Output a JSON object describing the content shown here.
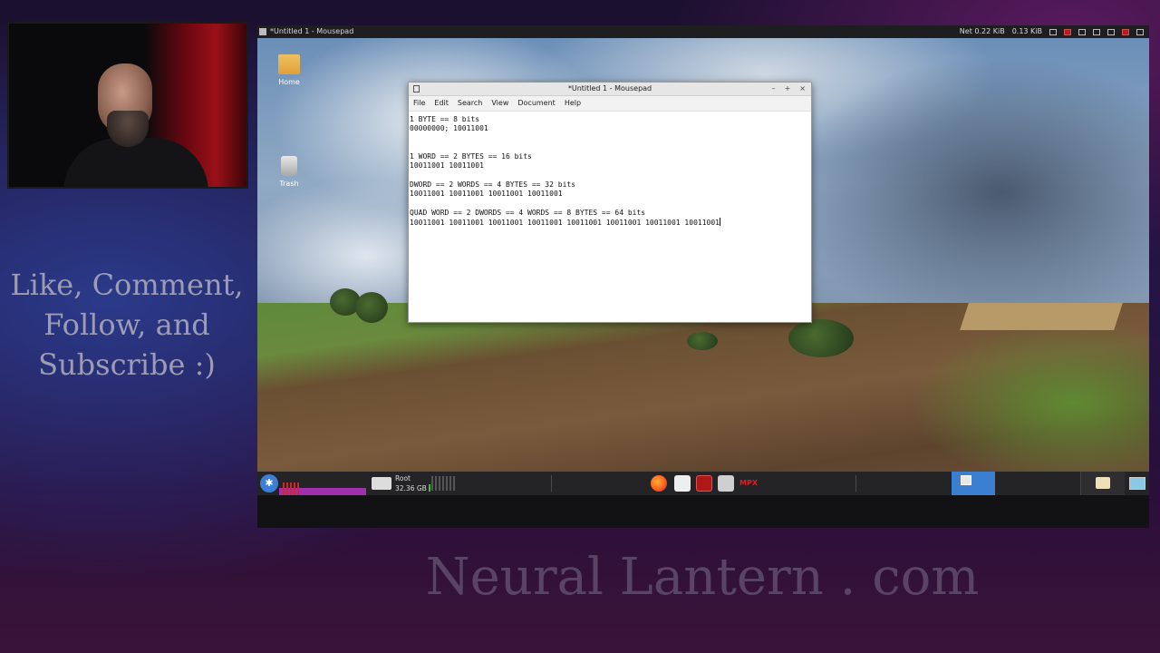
{
  "overlay": {
    "cta_lines": [
      "Like, Comment,",
      "Follow, and",
      "Subscribe :)"
    ],
    "brand": "Neural Lantern . com"
  },
  "top_panel": {
    "active_window": "*Untitled 1 - Mousepad",
    "net_label": "Net 0.22 KiB",
    "net_rate": "0.13 KiB"
  },
  "desktop_icons": [
    {
      "label": "Home",
      "icon": "folder-icon"
    },
    {
      "label": "Trash",
      "icon": "trash-icon"
    }
  ],
  "window": {
    "title": "*Untitled 1 - Mousepad",
    "controls": [
      "–",
      "+",
      "×"
    ],
    "menu": [
      "File",
      "Edit",
      "Search",
      "View",
      "Document",
      "Help"
    ],
    "lines": [
      "1 BYTE == 8 bits",
      "00000000; 10011001",
      "",
      "",
      "1 WORD == 2 BYTES == 16 bits",
      "10011001 10011001",
      "",
      "DWORD == 2 WORDS == 4 BYTES == 32 bits",
      "10011001 10011001 10011001 10011001",
      "",
      "QUAD WORD == 2 DWORDS == 4 WORDS == 8 BYTES == 64 bits",
      "10011001 10011001 10011001 10011001 10011001 10011001 10011001 10011001"
    ]
  },
  "bottom_panel": {
    "disk_label": "Root",
    "disk_free": "32.36 GB",
    "mpx_label": "MPX"
  },
  "colors": {
    "accent": "#3a7fd0",
    "panel": "#242426"
  }
}
